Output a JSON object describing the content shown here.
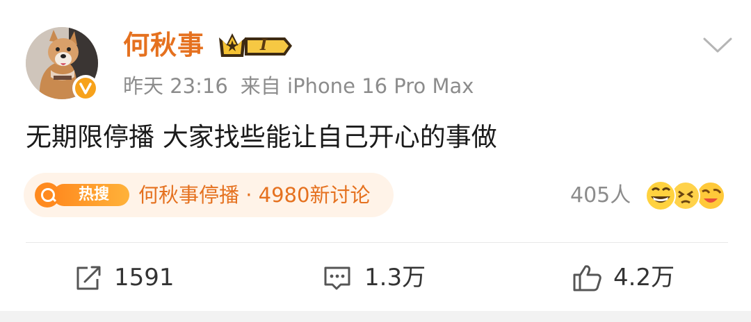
{
  "post": {
    "author": "何秋事",
    "vip_level": "I",
    "timestamp": "昨天 23:16",
    "source": "来自 iPhone 16 Pro Max",
    "text": "无期限停播 大家找些能让自己开心的事做",
    "hot_search": {
      "tag_label": "热搜",
      "topic": "何秋事停播 · 4980新讨论"
    },
    "reaction_count": "405人",
    "reaction_icons": [
      "grin-emoji-icon",
      "wince-emoji-icon",
      "laugh-cry-emoji-icon"
    ],
    "actions": {
      "repost": "1591",
      "comment": "1.3万",
      "like": "4.2万"
    }
  },
  "colors": {
    "brand_orange": "#e5711f",
    "meta_gray": "#8c8c8c",
    "pill_bg": "#fff3e8"
  }
}
